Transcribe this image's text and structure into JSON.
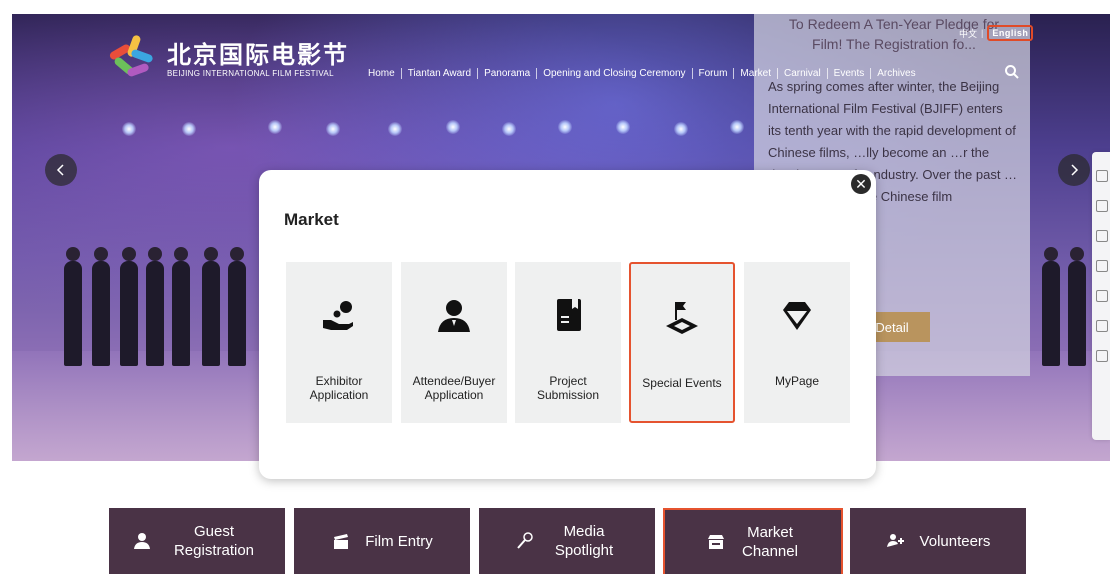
{
  "header": {
    "logo_cn": "北京国际电影节",
    "logo_en": "BEIJING INTERNATIONAL FILM FESTIVAL",
    "lang_cn": "中文",
    "lang_en": "English",
    "nav": [
      "Home",
      "Tiantan Award",
      "Panorama",
      "Opening and Closing Ceremony",
      "Forum",
      "Market",
      "Carnival",
      "Events",
      "Archives"
    ],
    "search_icon": "search-icon"
  },
  "news": {
    "title": "To Redeem A Ten-Year Pledge for Film! The Registration fo...",
    "body": "As spring comes after winter, the Beijing International Film Festival (BJIFF) enters its tenth year with the rapid development of Chinese films, …lly become an …r the development of …ndustry. Over the past …to the vigorous …e Chinese film",
    "button": "Detail"
  },
  "modal": {
    "title": "Market",
    "close_icon": "close-icon",
    "cards": [
      {
        "label": "Exhibitor Application",
        "icon": "exhibitor-icon",
        "selected": false
      },
      {
        "label": "Attendee/Buyer Application",
        "icon": "attendee-icon",
        "selected": false
      },
      {
        "label": "Project Submission",
        "icon": "project-icon",
        "selected": false
      },
      {
        "label": "Special Events",
        "icon": "special-events-icon",
        "selected": true
      },
      {
        "label": "MyPage",
        "icon": "mypage-icon",
        "selected": false
      }
    ]
  },
  "bottom_tabs": [
    {
      "label": "Guest Registration",
      "icon": "guest-icon",
      "active": false
    },
    {
      "label": "Film Entry",
      "icon": "film-icon",
      "active": false
    },
    {
      "label": "Media Spotlight",
      "icon": "microphone-icon",
      "active": false
    },
    {
      "label": "Market Channel",
      "icon": "market-icon",
      "active": true
    },
    {
      "label": "Volunteers",
      "icon": "volunteers-icon",
      "active": false
    }
  ],
  "colors": {
    "accent": "#e5532f",
    "tab_bg": "#4a3346",
    "card_bg": "#eff0f0",
    "detail_btn": "#b9945e"
  }
}
